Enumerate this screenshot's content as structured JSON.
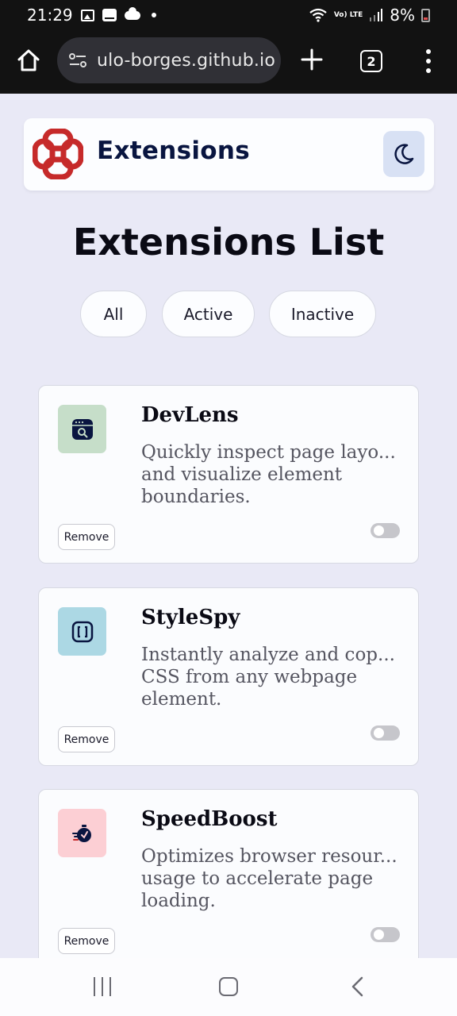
{
  "status_bar": {
    "time": "21:29",
    "battery": "8%",
    "icons": [
      "image-icon",
      "notification-icon",
      "cloud-icon",
      "dot-icon",
      "wifi-icon",
      "volte-icon",
      "signal-icon",
      "battery-icon"
    ],
    "lte_label": "Vo) LTE"
  },
  "browser": {
    "url": "ulo-borges.github.io",
    "tab_count": "2"
  },
  "header": {
    "brand_name": "Extensions",
    "logo_color": "#c62a2a",
    "brand_color": "#091540",
    "theme_button_bg": "#d8e1f4"
  },
  "main": {
    "title": "Extensions List",
    "filters": [
      {
        "label": "All"
      },
      {
        "label": "Active"
      },
      {
        "label": "Inactive"
      }
    ]
  },
  "extensions": [
    {
      "name": "DevLens",
      "desc_line1": "Quickly inspect page layo...",
      "desc_rest": "and visualize element boundaries.",
      "remove_label": "Remove",
      "icon_color": "#c6dec9",
      "active": false
    },
    {
      "name": "StyleSpy",
      "desc_line1": "Instantly analyze and cop...",
      "desc_rest": "CSS from any webpage element.",
      "remove_label": "Remove",
      "icon_color": "#acd8e4",
      "active": false
    },
    {
      "name": "SpeedBoost",
      "desc_line1": "Optimizes browser resour...",
      "desc_rest": "usage to accelerate page loading.",
      "remove_label": "Remove",
      "icon_color": "#fccfd4",
      "active": false
    }
  ]
}
